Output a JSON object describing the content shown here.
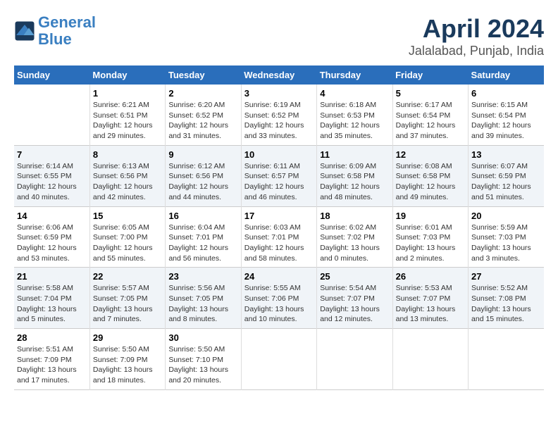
{
  "header": {
    "logo_line1": "General",
    "logo_line2": "Blue",
    "title": "April 2024",
    "subtitle": "Jalalabad, Punjab, India"
  },
  "columns": [
    "Sunday",
    "Monday",
    "Tuesday",
    "Wednesday",
    "Thursday",
    "Friday",
    "Saturday"
  ],
  "weeks": [
    [
      {
        "day": "",
        "info": ""
      },
      {
        "day": "1",
        "info": "Sunrise: 6:21 AM\nSunset: 6:51 PM\nDaylight: 12 hours\nand 29 minutes."
      },
      {
        "day": "2",
        "info": "Sunrise: 6:20 AM\nSunset: 6:52 PM\nDaylight: 12 hours\nand 31 minutes."
      },
      {
        "day": "3",
        "info": "Sunrise: 6:19 AM\nSunset: 6:52 PM\nDaylight: 12 hours\nand 33 minutes."
      },
      {
        "day": "4",
        "info": "Sunrise: 6:18 AM\nSunset: 6:53 PM\nDaylight: 12 hours\nand 35 minutes."
      },
      {
        "day": "5",
        "info": "Sunrise: 6:17 AM\nSunset: 6:54 PM\nDaylight: 12 hours\nand 37 minutes."
      },
      {
        "day": "6",
        "info": "Sunrise: 6:15 AM\nSunset: 6:54 PM\nDaylight: 12 hours\nand 39 minutes."
      }
    ],
    [
      {
        "day": "7",
        "info": "Sunrise: 6:14 AM\nSunset: 6:55 PM\nDaylight: 12 hours\nand 40 minutes."
      },
      {
        "day": "8",
        "info": "Sunrise: 6:13 AM\nSunset: 6:56 PM\nDaylight: 12 hours\nand 42 minutes."
      },
      {
        "day": "9",
        "info": "Sunrise: 6:12 AM\nSunset: 6:56 PM\nDaylight: 12 hours\nand 44 minutes."
      },
      {
        "day": "10",
        "info": "Sunrise: 6:11 AM\nSunset: 6:57 PM\nDaylight: 12 hours\nand 46 minutes."
      },
      {
        "day": "11",
        "info": "Sunrise: 6:09 AM\nSunset: 6:58 PM\nDaylight: 12 hours\nand 48 minutes."
      },
      {
        "day": "12",
        "info": "Sunrise: 6:08 AM\nSunset: 6:58 PM\nDaylight: 12 hours\nand 49 minutes."
      },
      {
        "day": "13",
        "info": "Sunrise: 6:07 AM\nSunset: 6:59 PM\nDaylight: 12 hours\nand 51 minutes."
      }
    ],
    [
      {
        "day": "14",
        "info": "Sunrise: 6:06 AM\nSunset: 6:59 PM\nDaylight: 12 hours\nand 53 minutes."
      },
      {
        "day": "15",
        "info": "Sunrise: 6:05 AM\nSunset: 7:00 PM\nDaylight: 12 hours\nand 55 minutes."
      },
      {
        "day": "16",
        "info": "Sunrise: 6:04 AM\nSunset: 7:01 PM\nDaylight: 12 hours\nand 56 minutes."
      },
      {
        "day": "17",
        "info": "Sunrise: 6:03 AM\nSunset: 7:01 PM\nDaylight: 12 hours\nand 58 minutes."
      },
      {
        "day": "18",
        "info": "Sunrise: 6:02 AM\nSunset: 7:02 PM\nDaylight: 13 hours\nand 0 minutes."
      },
      {
        "day": "19",
        "info": "Sunrise: 6:01 AM\nSunset: 7:03 PM\nDaylight: 13 hours\nand 2 minutes."
      },
      {
        "day": "20",
        "info": "Sunrise: 5:59 AM\nSunset: 7:03 PM\nDaylight: 13 hours\nand 3 minutes."
      }
    ],
    [
      {
        "day": "21",
        "info": "Sunrise: 5:58 AM\nSunset: 7:04 PM\nDaylight: 13 hours\nand 5 minutes."
      },
      {
        "day": "22",
        "info": "Sunrise: 5:57 AM\nSunset: 7:05 PM\nDaylight: 13 hours\nand 7 minutes."
      },
      {
        "day": "23",
        "info": "Sunrise: 5:56 AM\nSunset: 7:05 PM\nDaylight: 13 hours\nand 8 minutes."
      },
      {
        "day": "24",
        "info": "Sunrise: 5:55 AM\nSunset: 7:06 PM\nDaylight: 13 hours\nand 10 minutes."
      },
      {
        "day": "25",
        "info": "Sunrise: 5:54 AM\nSunset: 7:07 PM\nDaylight: 13 hours\nand 12 minutes."
      },
      {
        "day": "26",
        "info": "Sunrise: 5:53 AM\nSunset: 7:07 PM\nDaylight: 13 hours\nand 13 minutes."
      },
      {
        "day": "27",
        "info": "Sunrise: 5:52 AM\nSunset: 7:08 PM\nDaylight: 13 hours\nand 15 minutes."
      }
    ],
    [
      {
        "day": "28",
        "info": "Sunrise: 5:51 AM\nSunset: 7:09 PM\nDaylight: 13 hours\nand 17 minutes."
      },
      {
        "day": "29",
        "info": "Sunrise: 5:50 AM\nSunset: 7:09 PM\nDaylight: 13 hours\nand 18 minutes."
      },
      {
        "day": "30",
        "info": "Sunrise: 5:50 AM\nSunset: 7:10 PM\nDaylight: 13 hours\nand 20 minutes."
      },
      {
        "day": "",
        "info": ""
      },
      {
        "day": "",
        "info": ""
      },
      {
        "day": "",
        "info": ""
      },
      {
        "day": "",
        "info": ""
      }
    ]
  ]
}
